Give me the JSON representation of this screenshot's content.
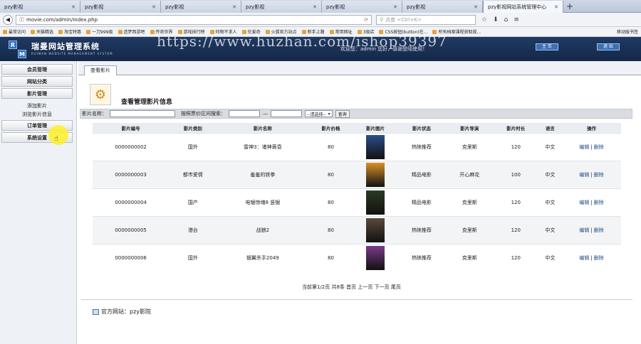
{
  "browser": {
    "tabs": [
      {
        "title": "pzy影视",
        "active": false
      },
      {
        "title": "pzy影视",
        "active": false
      },
      {
        "title": "pzy影视",
        "active": false
      },
      {
        "title": "pzy影视",
        "active": false
      },
      {
        "title": "pzy影视",
        "active": false
      },
      {
        "title": "pzy影视",
        "active": false
      },
      {
        "title": "pzy影视网站系统管理中心",
        "active": true
      }
    ],
    "url": "movie.com/admin/index.php",
    "search_placeholder": "点度 <Ctrl+K>",
    "bookmarks": [
      "最常访问",
      "天猫精选",
      "淘宝特惠",
      "一刀999级",
      "造梦西游吧",
      "传奇世界",
      "游戏排行榜",
      "何物不求人",
      "优爱奇",
      "火狐官方站点",
      "新手上路",
      "常用网址",
      "3级店",
      "CSS按钮(button)在...",
      "所有档案课程获取规..."
    ],
    "bookmarks_other": "移动版书签"
  },
  "app": {
    "title": "瑞曼网站管理系统",
    "subtitle": "RUIMAN WEBSITE MANAGEMENT SYSTEM",
    "welcome": "欢迎您：admin 您好，感谢登陆使用！",
    "home_button": "主 页",
    "logout_button": "退 出",
    "watermark": "https://www.huzhan.com/ishop39397"
  },
  "sidebar": {
    "menu_members": "会员管理",
    "menu_categories": "网站分类",
    "menu_films": "影片管理",
    "sub_add": "添加影片",
    "sub_browse": "浏览影片信息",
    "menu_orders": "订单管理",
    "menu_settings": "系统设置"
  },
  "main": {
    "tab_label": "查看影片",
    "heading": "查看管理影片信息",
    "search": {
      "name_label": "影片名称：",
      "price_label": "按照票价区间搜索：",
      "range_sep": "—",
      "select_value": "--请选择--",
      "query_button": "查询"
    },
    "columns": [
      "影片编号",
      "影片类别",
      "影片名称",
      "影片价格",
      "影片图片",
      "影片状态",
      "影片导演",
      "影片时长",
      "语言",
      "操作"
    ],
    "rows": [
      {
        "id": "0000000002",
        "category": "国外",
        "name": "雷神3：诸神黄昏",
        "price": "80",
        "status": "热映推荐",
        "director": "克里斯",
        "duration": "120",
        "language": "中文",
        "poster_color": "#2a4f8a"
      },
      {
        "id": "0000000003",
        "category": "都市爱情",
        "name": "羞羞的铁拳",
        "price": "80",
        "status": "精品电影",
        "director": "开心麻花",
        "duration": "100",
        "language": "中文",
        "poster_color": "#d8902a"
      },
      {
        "id": "0000000004",
        "category": "国产",
        "name": "电锯惊魂8 竖锯",
        "price": "80",
        "status": "精品电影",
        "director": "克里斯",
        "duration": "120",
        "language": "中文",
        "poster_color": "#2b3b24"
      },
      {
        "id": "0000000005",
        "category": "港台",
        "name": "战狼2",
        "price": "80",
        "status": "热映推荐",
        "director": "克里斯",
        "duration": "120",
        "language": "中文",
        "poster_color": "#5a4a3a"
      },
      {
        "id": "0000000006",
        "category": "国外",
        "name": "银翼杀手2049",
        "price": "80",
        "status": "热映推荐",
        "director": "克里斯",
        "duration": "120",
        "language": "中文",
        "poster_color": "#7a3a8a"
      }
    ],
    "edit_label": "编辑",
    "delete_label": "删除",
    "action_sep": "|",
    "pager": "当前第1/2页 共8条 首页 上一页 下一页 尾页",
    "footer": "官方网站：pzy影院"
  }
}
